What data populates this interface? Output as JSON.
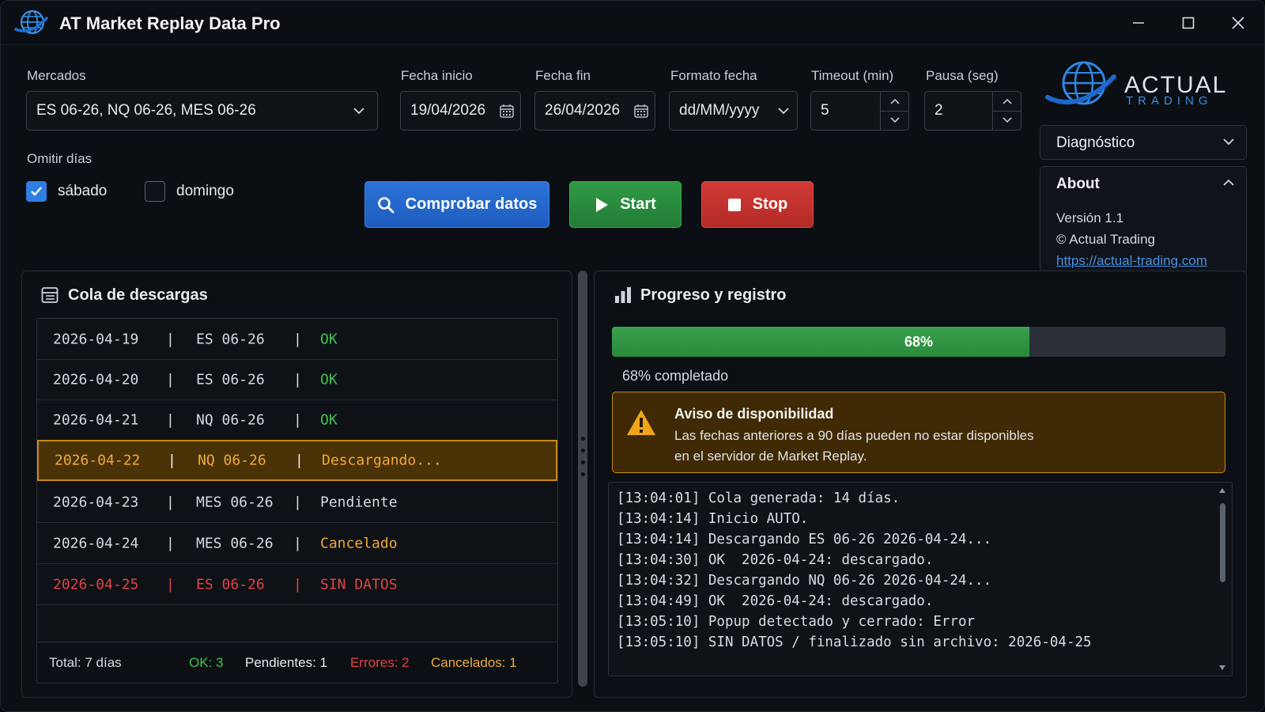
{
  "window": {
    "title": "AT Market Replay Data Pro"
  },
  "filters": {
    "markets_label": "Mercados",
    "markets_value": "ES 06-26, NQ 06-26, MES 06-26",
    "start_label": "Fecha inicio",
    "start_value": "19/04/2026",
    "end_label": "Fecha fin",
    "end_value": "26/04/2026",
    "format_label": "Formato fecha",
    "format_value": "dd/MM/yyyy",
    "timeout_label": "Timeout (min)",
    "timeout_value": "5",
    "pause_label": "Pausa (seg)",
    "pause_value": "2",
    "omit_label": "Omitir días",
    "saturday_label": "sábado",
    "saturday_checked": true,
    "sunday_label": "domingo",
    "sunday_checked": false
  },
  "actions": {
    "check_label": "Comprobar datos",
    "start_label": "Start",
    "stop_label": "Stop"
  },
  "brand": {
    "name": "ACTUAL",
    "sub": "TRADING"
  },
  "sidebar": {
    "diagnostic_label": "Diagnóstico",
    "about_label": "About",
    "version": "Versión 1.1",
    "copyright": "© Actual Trading",
    "link": "https://actual-trading.com"
  },
  "queue": {
    "title": "Cola de descargas",
    "rows": [
      {
        "date": "2026-04-19",
        "symbol": "ES 06-26",
        "status": "OK",
        "kind": "ok"
      },
      {
        "date": "2026-04-20",
        "symbol": "ES 06-26",
        "status": "OK",
        "kind": "ok"
      },
      {
        "date": "2026-04-21",
        "symbol": "NQ 06-26",
        "status": "OK",
        "kind": "ok"
      },
      {
        "date": "2026-04-22",
        "symbol": "NQ 06-26",
        "status": "Descargando...",
        "kind": "active"
      },
      {
        "date": "2026-04-23",
        "symbol": "MES 06-26",
        "status": "Pendiente",
        "kind": "pending"
      },
      {
        "date": "2026-04-24",
        "symbol": "MES 06-26",
        "status": "Cancelado",
        "kind": "cancel"
      },
      {
        "date": "2026-04-25",
        "symbol": "ES 06-26",
        "status": "SIN DATOS",
        "kind": "error"
      }
    ],
    "summary": {
      "total": "Total: 7 días",
      "ok": "OK: 3",
      "pending": "Pendientes: 1",
      "errors": "Errores: 2",
      "cancelled": "Cancelados: 1"
    }
  },
  "progress": {
    "title": "Progreso y registro",
    "percent": 68,
    "percent_label": "68%",
    "caption": "68% completado"
  },
  "warning": {
    "title": "Aviso de disponibilidad",
    "line1": "Las fechas anteriores a 90 días pueden no estar disponibles",
    "line2": "en el servidor de Market Replay."
  },
  "log": [
    "[13:04:01] Cola generada: 14 días.",
    "[13:04:14] Inicio AUTO.",
    "[13:04:14] Descargando ES 06-26 2026-04-24...",
    "[13:04:30] OK  2026-04-24: descargado.",
    "[13:04:32] Descargando NQ 06-26 2026-04-24...",
    "[13:04:49] OK  2026-04-24: descargado.",
    "[13:05:10] Popup detectado y cerrado: Error",
    "[13:05:10] SIN DATOS / finalizado sin archivo: 2026-04-25"
  ],
  "colors": {
    "accent_blue": "#2c72d8",
    "start_green": "#2f9a45",
    "stop_red": "#d23a36",
    "ok_green": "#3fc44f",
    "warn_orange": "#f0a93a",
    "error_red": "#e04444"
  },
  "icons": {
    "app": "globe-icon",
    "calendar": "calendar-icon",
    "search": "search-icon",
    "play": "play-icon",
    "stop": "stop-icon",
    "queue": "list-icon",
    "progress": "bar-chart-icon",
    "warning": "warning-icon"
  }
}
